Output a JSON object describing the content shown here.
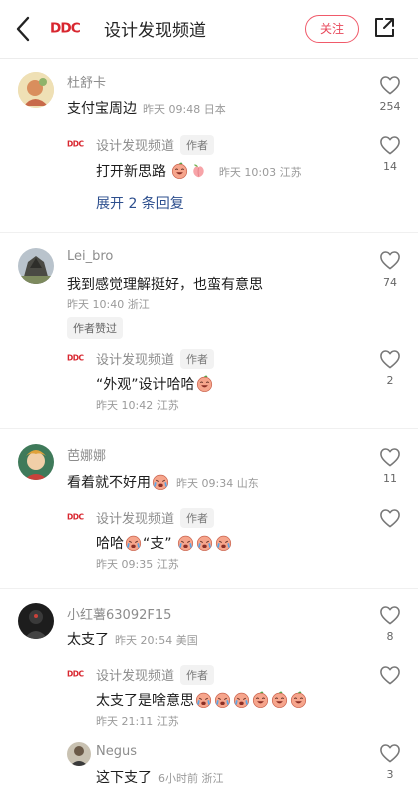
{
  "header": {
    "logo_text": "DDC",
    "title": "设计发现频道",
    "follow_label": "关注"
  },
  "colors": {
    "accent": "#e8475a",
    "link": "#2d4f8e",
    "meta": "#9a9a9a"
  },
  "author_tag": "作者",
  "channel_name": "设计发现频道",
  "comments": [
    {
      "user": "杜舒卡",
      "text": "支付宝周边",
      "meta": "昨天 09:48 日本",
      "likes": "254",
      "reply": {
        "text": "打开新思路",
        "meta": "昨天 10:03 江苏",
        "likes": "14"
      },
      "expand": "展开 2 条回复"
    },
    {
      "user": "Lei_bro",
      "text": "我到感觉理解挺好，也蛮有意思",
      "meta": "昨天 10:40 浙江",
      "badge": "作者赞过",
      "likes": "74",
      "reply": {
        "text": "“外观”设计哈哈",
        "meta": "昨天 10:42 江苏",
        "likes": "2"
      }
    },
    {
      "user": "芭娜娜",
      "text": "看着就不好用",
      "meta": "昨天 09:34 山东",
      "likes": "11",
      "reply": {
        "text_a": "哈哈",
        "text_b": "“支”",
        "meta": "昨天 09:35 江苏",
        "likes": ""
      }
    },
    {
      "user": "小红薯63092F15",
      "text": "太支了",
      "meta": "昨天 20:54 美国",
      "likes": "8",
      "reply": {
        "text": "太支了是啥意思",
        "meta": "昨天 21:11 江苏",
        "likes": ""
      },
      "reply2": {
        "user": "Negus",
        "text": "这下支了",
        "meta": "6小时前 浙江",
        "likes": "3"
      }
    }
  ]
}
